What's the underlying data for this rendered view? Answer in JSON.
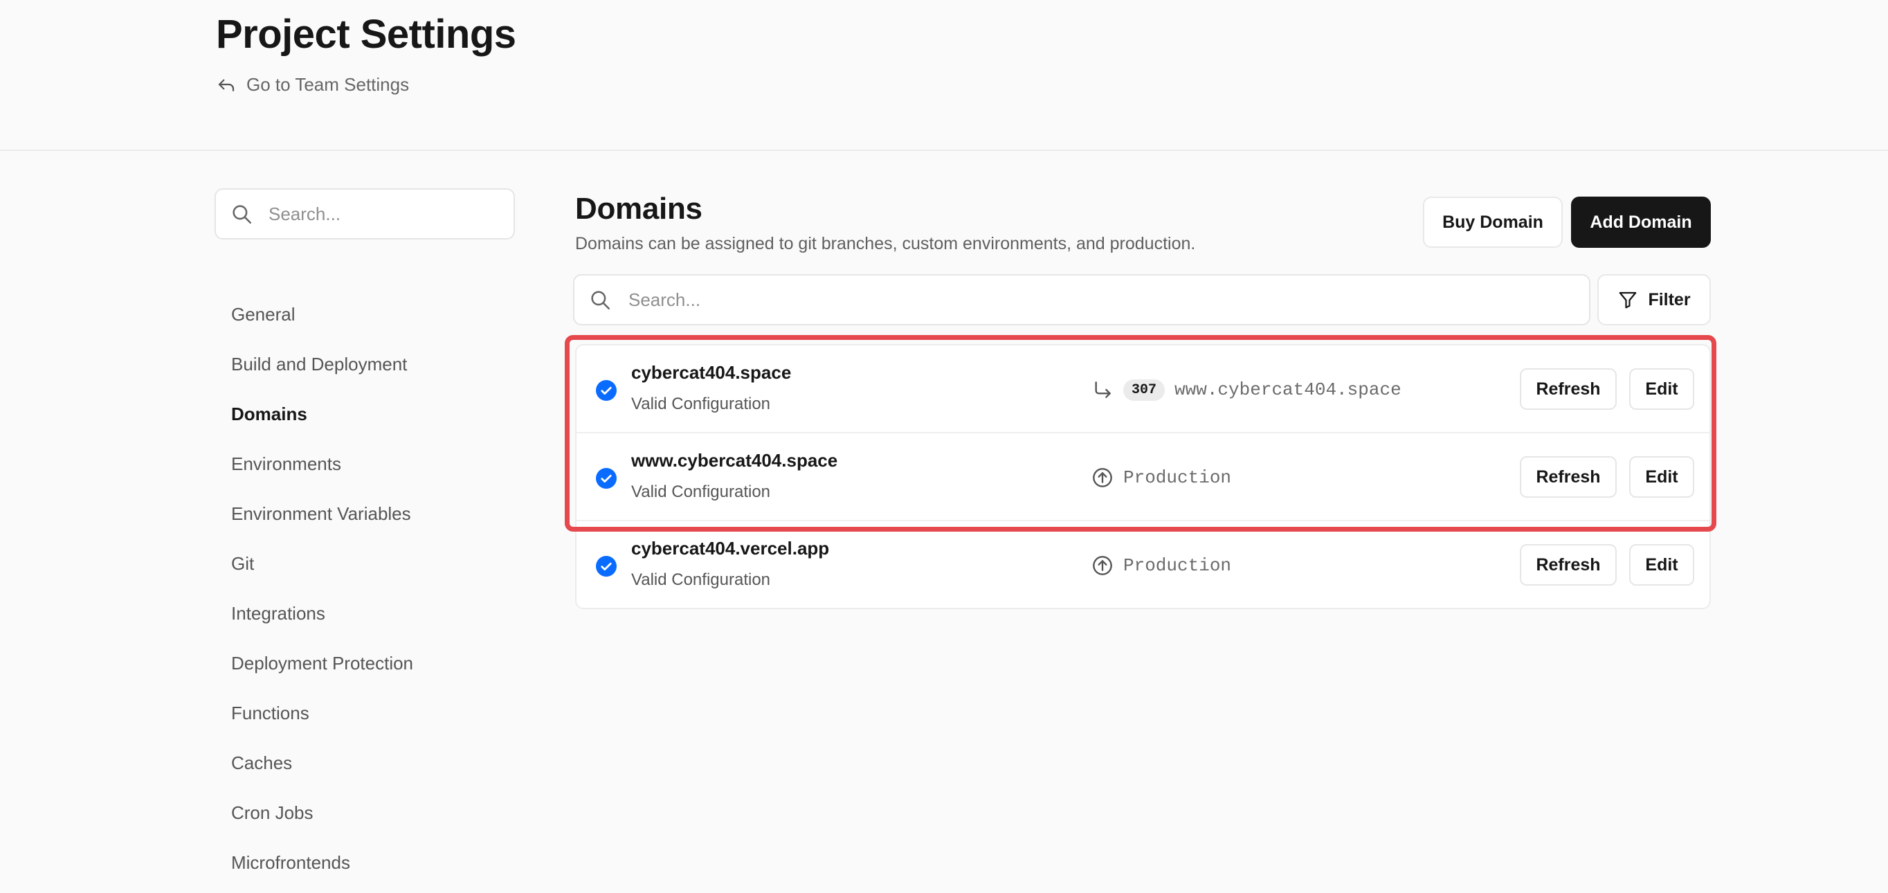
{
  "header": {
    "title": "Project Settings",
    "back_link": "Go to Team Settings"
  },
  "sidebar": {
    "search_placeholder": "Search...",
    "items": [
      {
        "label": "General"
      },
      {
        "label": "Build and Deployment"
      },
      {
        "label": "Domains",
        "active": true
      },
      {
        "label": "Environments"
      },
      {
        "label": "Environment Variables"
      },
      {
        "label": "Git"
      },
      {
        "label": "Integrations"
      },
      {
        "label": "Deployment Protection"
      },
      {
        "label": "Functions"
      },
      {
        "label": "Caches"
      },
      {
        "label": "Cron Jobs"
      },
      {
        "label": "Microfrontends"
      }
    ]
  },
  "main": {
    "title": "Domains",
    "description": "Domains can be assigned to git branches, custom environments, and production.",
    "buy_domain_label": "Buy Domain",
    "add_domain_label": "Add Domain",
    "search_placeholder": "Search...",
    "filter_label": "Filter",
    "domains": [
      {
        "name": "cybercat404.space",
        "status": "Valid Configuration",
        "redirect_code": "307",
        "target": "www.cybercat404.space",
        "target_icon": "redirect-arrow-icon",
        "refresh_label": "Refresh",
        "edit_label": "Edit"
      },
      {
        "name": "www.cybercat404.space",
        "status": "Valid Configuration",
        "target": "Production",
        "target_icon": "production-arrow-up-icon",
        "refresh_label": "Refresh",
        "edit_label": "Edit"
      },
      {
        "name": "cybercat404.vercel.app",
        "status": "Valid Configuration",
        "target": "Production",
        "target_icon": "production-arrow-up-icon",
        "refresh_label": "Refresh",
        "edit_label": "Edit"
      }
    ]
  },
  "colors": {
    "background": "#fafafa",
    "primary_button": "#171717",
    "valid_check": "#0a6cff",
    "highlight_box": "#e5484d"
  }
}
